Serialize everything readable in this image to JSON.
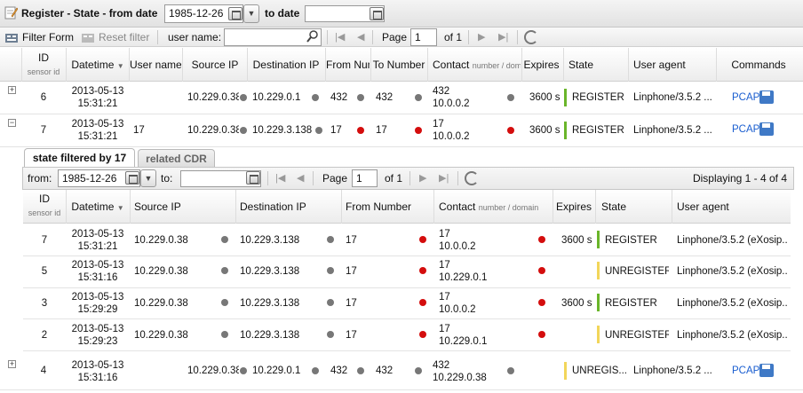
{
  "title": {
    "main": "Register - State - from date",
    "date_from": "1985-12-26",
    "to_label": "to date",
    "date_to": ""
  },
  "toolbar": {
    "filter_form": "Filter Form",
    "reset_filter": "Reset filter",
    "username_label": "user name:",
    "username_value": "",
    "page_label": "Page",
    "page_value": "1",
    "of_label": "of 1"
  },
  "grid": {
    "headers": {
      "id": "ID",
      "id_sub": "sensor id",
      "datetime": "Datetime",
      "username": "User name",
      "source_ip": "Source IP",
      "dest_ip": "Destination IP",
      "from_number": "From Numb",
      "to_number": "To Number",
      "contact": "Contact",
      "contact_sub": "number / domai",
      "expires": "Expires",
      "state": "State",
      "user_agent": "User agent",
      "commands": "Commands"
    },
    "rows": [
      {
        "id": "6",
        "date": "2013-05-13",
        "time": "15:31:21",
        "username": "",
        "source_ip": "10.229.0.38",
        "dest_ip": "10.229.0.1",
        "from": "432",
        "to": "432",
        "contact1": "432",
        "contact2": "10.0.0.2",
        "expires": "3600 s",
        "state": "REGISTER",
        "user_agent": "Linphone/3.5.2 ...",
        "command": "PCAP"
      },
      {
        "id": "7",
        "date": "2013-05-13",
        "time": "15:31:21",
        "username": "17",
        "source_ip": "10.229.0.38",
        "dest_ip": "10.229.3.138",
        "from": "17",
        "to": "17",
        "contact1": "17",
        "contact2": "10.0.0.2",
        "expires": "3600 s",
        "state": "REGISTER",
        "user_agent": "Linphone/3.5.2 ...",
        "command": "PCAP"
      },
      {
        "id": "4",
        "date": "2013-05-13",
        "time": "15:31:16",
        "username": "",
        "source_ip": "10.229.0.38",
        "dest_ip": "10.229.0.1",
        "from": "432",
        "to": "432",
        "contact1": "432",
        "contact2": "10.229.0.38",
        "expires": "",
        "state": "UNREGIS...",
        "user_agent": "Linphone/3.5.2 ...",
        "command": "PCAP"
      }
    ]
  },
  "subpanel": {
    "tabs": [
      "state filtered by 17",
      "related CDR"
    ],
    "from_label": "from:",
    "from_value": "1985-12-26",
    "to_label": "to:",
    "to_value": "",
    "page_label": "Page",
    "page_value": "1",
    "of_label": "of 1",
    "displaying": "Displaying 1 - 4 of 4",
    "headers": {
      "id": "ID",
      "id_sub": "sensor id",
      "datetime": "Datetime",
      "source_ip": "Source IP",
      "dest_ip": "Destination IP",
      "from_number": "From Number",
      "contact": "Contact",
      "contact_sub": "number / domain",
      "expires": "Expires",
      "state": "State",
      "user_agent": "User agent"
    },
    "rows": [
      {
        "id": "7",
        "date": "2013-05-13",
        "time": "15:31:21",
        "source_ip": "10.229.0.38",
        "dest_ip": "10.229.3.138",
        "from": "17",
        "contact1": "17",
        "contact2": "10.0.0.2",
        "expires": "3600 s",
        "state": "REGISTER",
        "user_agent": "Linphone/3.5.2 (eXosip..."
      },
      {
        "id": "5",
        "date": "2013-05-13",
        "time": "15:31:16",
        "source_ip": "10.229.0.38",
        "dest_ip": "10.229.3.138",
        "from": "17",
        "contact1": "17",
        "contact2": "10.229.0.1",
        "expires": "",
        "state": "UNREGISTER",
        "user_agent": "Linphone/3.5.2 (eXosip..."
      },
      {
        "id": "3",
        "date": "2013-05-13",
        "time": "15:29:29",
        "source_ip": "10.229.0.38",
        "dest_ip": "10.229.3.138",
        "from": "17",
        "contact1": "17",
        "contact2": "10.0.0.2",
        "expires": "3600 s",
        "state": "REGISTER",
        "user_agent": "Linphone/3.5.2 (eXosip..."
      },
      {
        "id": "2",
        "date": "2013-05-13",
        "time": "15:29:23",
        "source_ip": "10.229.0.38",
        "dest_ip": "10.229.3.138",
        "from": "17",
        "contact1": "17",
        "contact2": "10.229.0.1",
        "expires": "",
        "state": "UNREGISTER",
        "user_agent": "Linphone/3.5.2 (eXosip..."
      }
    ]
  },
  "colors": {
    "register": "#6ab52a",
    "unregister": "#f2d65a",
    "dot_gray": "#777777",
    "dot_red": "#d40d0d"
  }
}
